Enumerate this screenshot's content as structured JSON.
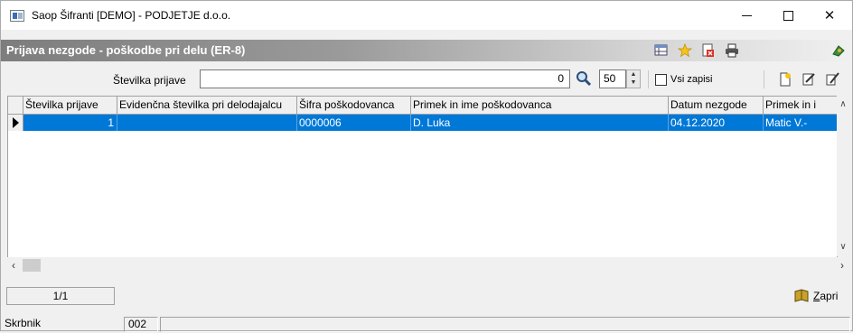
{
  "window": {
    "title": "Saop Šifranti [DEMO] - PODJETJE d.o.o.",
    "min_symbol": "",
    "close_symbol": "✕"
  },
  "header": {
    "title": "Prijava nezgode - poškodbe pri delu (ER-8)"
  },
  "search": {
    "label": "Številka prijave",
    "value": "0",
    "limit": "50",
    "all_records_label": "Vsi zapisi",
    "all_records_checked": false
  },
  "grid": {
    "columns": [
      "Številka prijave",
      "Evidenčna številka pri delodajalcu",
      "Šifra poškodovanca",
      "Primek in ime poškodovanca",
      "Datum nezgode",
      "Primek in i"
    ],
    "rows": [
      {
        "stevilka": "1",
        "evidencna": "",
        "sifra": "0000006",
        "ime": "D. Luka",
        "datum": "04.12.2020",
        "primek2": "Matic V.-"
      }
    ]
  },
  "footer": {
    "record_count": "1/1",
    "close_label": "Zapri"
  },
  "statusbar": {
    "label": "Skrbnik",
    "code": "002"
  },
  "colors": {
    "selection": "#0078d7",
    "header_gradient_start": "#7d7d7d"
  }
}
